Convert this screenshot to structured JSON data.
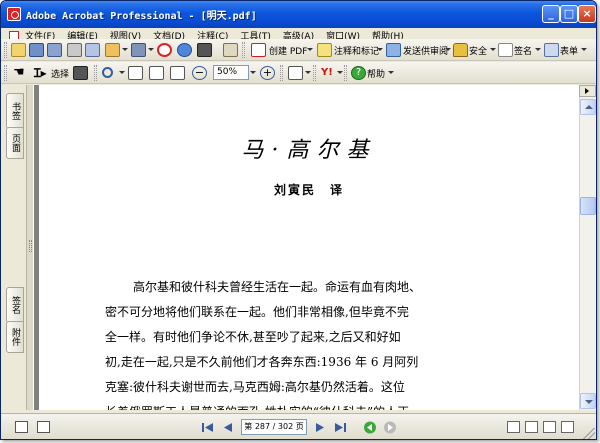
{
  "window": {
    "title": "Adobe Acrobat Professional - [明天.pdf]"
  },
  "menu": {
    "items": [
      "文件(F)",
      "编辑(E)",
      "视图(V)",
      "文档(D)",
      "注释(C)",
      "工具(T)",
      "高级(A)",
      "窗口(W)",
      "帮助(H)"
    ]
  },
  "toolbar1": {
    "create_pdf": "创建 PDF",
    "comment_markup": "注释和标记",
    "send_review": "发送供审阅",
    "security": "安全",
    "sign": "签名",
    "forms": "表单"
  },
  "toolbar2": {
    "select_label": "选择",
    "zoom_value": "50%",
    "help_label": "帮助"
  },
  "navpane": {
    "tabs": [
      "书签",
      "页面",
      "签名",
      "附件"
    ]
  },
  "document": {
    "title": "马·高尔基",
    "translator": "刘寅民　译",
    "body_lines": [
      "高尔基和彼什科夫曾经生活在一起。命运有血有肉地、",
      "密不可分地将他们联系在一起。他们非常相像,但毕竟不完",
      "全一样。有时他们争论不休,甚至吵了起来,之后又和好如",
      "初,走在一起,只是不久前他们才各奔东西:1936 年 6 月阿列",
      "克塞:彼什科夫谢世而去,马克西姆:高尔基仍然活着。这位",
      "长着俄罗斯工人最普通的面孔,姓朴实的“彼什科夫”的人正"
    ]
  },
  "statusbar": {
    "page_field": "第 287 / 302 页"
  },
  "colors": {
    "titlebar": "#0a4fd6",
    "chrome": "#ece9d8",
    "doc_background": "#808080",
    "acrobat_red": "#d22222"
  },
  "icons": [
    "app-icon",
    "hand-icon",
    "select-text-icon",
    "snapshot-icon",
    "zoom-icon",
    "help-icon",
    "first-page-icon",
    "prev-page-icon",
    "next-page-icon",
    "last-page-icon",
    "back-icon",
    "forward-icon"
  ]
}
